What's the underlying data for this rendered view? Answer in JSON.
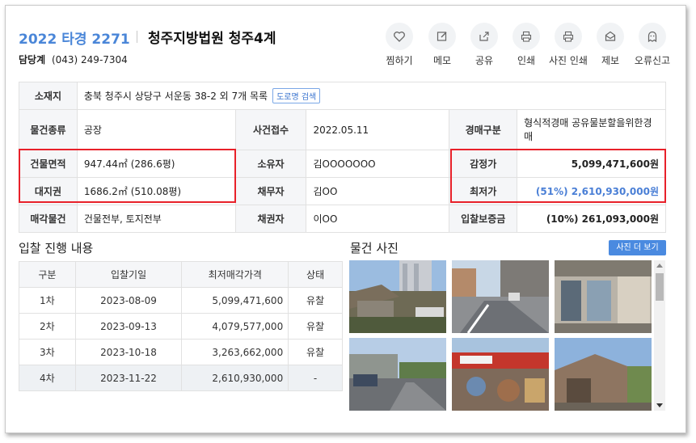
{
  "header": {
    "case_number": "2022 타경 2271",
    "court": "청주지방법원 청주4계",
    "dept_name": "담당계",
    "dept_phone": "(043) 249-7304"
  },
  "actions": [
    {
      "label": "찜하기",
      "icon": "heart-icon"
    },
    {
      "label": "메모",
      "icon": "edit-icon"
    },
    {
      "label": "공유",
      "icon": "share-icon"
    },
    {
      "label": "인쇄",
      "icon": "printer-icon"
    },
    {
      "label": "사진 인쇄",
      "icon": "photo-print-icon"
    },
    {
      "label": "제보",
      "icon": "mail-icon"
    },
    {
      "label": "오류신고",
      "icon": "ghost-icon"
    }
  ],
  "info": {
    "location_label": "소재지",
    "location_value": "충북 청주시 상당구 서운동 38-2 외 7개 목록",
    "road_button": "도로명 검색",
    "type_label": "물건종류",
    "type_value": "공장",
    "received_label": "사건접수",
    "received_value": "2022.05.11",
    "auction_type_label": "경매구분",
    "auction_type_value": "형식적경매 공유물분할을위한경매",
    "building_area_label": "건물면적",
    "building_area_value": "947.44㎡ (286.6평)",
    "owner_label": "소유자",
    "owner_value": "김OOOOOOO",
    "appraisal_label": "감정가",
    "appraisal_value": "5,099,471,600원",
    "land_label": "대지권",
    "land_value": "1686.2㎡ (510.08평)",
    "debtor_label": "채무자",
    "debtor_value": "김OO",
    "min_price_label": "최저가",
    "min_price_value": "(51%) 2,610,930,000원",
    "sale_items_label": "매각물건",
    "sale_items_value": "건물전부, 토지전부",
    "creditor_label": "채권자",
    "creditor_value": "이OO",
    "deposit_label": "입찰보증금",
    "deposit_value": "(10%) 261,093,000원"
  },
  "bid_section": {
    "title": "입찰 진행 내용",
    "headers": [
      "구분",
      "입찰기일",
      "최저매각가격",
      "상태"
    ],
    "rows": [
      [
        "1차",
        "2023-08-09",
        "5,099,471,600",
        "유찰"
      ],
      [
        "2차",
        "2023-09-13",
        "4,079,577,000",
        "유찰"
      ],
      [
        "3차",
        "2023-10-18",
        "3,263,662,000",
        "유찰"
      ],
      [
        "4차",
        "2023-11-22",
        "2,610,930,000",
        "-"
      ]
    ]
  },
  "photo_section": {
    "title": "물건 사진",
    "more_button": "사진 더 보기"
  },
  "colors": {
    "accent_blue": "#4a86d8",
    "highlight_red": "#e8212a",
    "header_bg": "#f5f6f8"
  }
}
